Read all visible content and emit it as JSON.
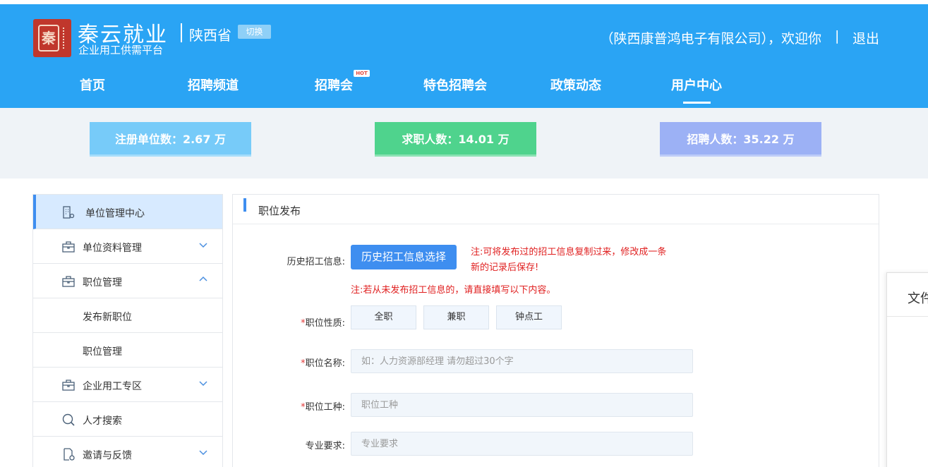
{
  "header": {
    "brand_title": "秦云就业",
    "brand_sub": "企业用工供需平台",
    "seal_char": "秦",
    "province": "陕西省",
    "switch_label": "切换",
    "welcome": "（陕西康普鸿电子有限公司），欢迎你",
    "separator": "|",
    "logout": "退出",
    "brand_color": "#2aa4f4"
  },
  "nav": {
    "items": [
      {
        "label": "首页"
      },
      {
        "label": "招聘频道"
      },
      {
        "label": "招聘会",
        "badge": "HOT"
      },
      {
        "label": "特色招聘会"
      },
      {
        "label": "政策动态"
      },
      {
        "label": "用户中心",
        "active": true
      }
    ]
  },
  "stats": [
    {
      "label": "注册单位数：2.67 万",
      "color": "#77cbf9"
    },
    {
      "label": "求职人数：14.01 万",
      "color": "#4fd38d"
    },
    {
      "label": "招聘人数：35.22 万",
      "color": "#9cb1f5"
    }
  ],
  "sidebar": {
    "items": [
      {
        "label": "单位管理中心",
        "icon": "building-icon",
        "active": true
      },
      {
        "label": "单位资料管理",
        "icon": "briefcase-icon",
        "chevron": "down"
      },
      {
        "label": "职位管理",
        "icon": "briefcase-icon",
        "chevron": "up"
      },
      {
        "label": "发布新职位"
      },
      {
        "label": "职位管理"
      },
      {
        "label": "企业用工专区",
        "icon": "briefcase-icon",
        "chevron": "down"
      },
      {
        "label": "人才搜索",
        "icon": "search-icon"
      },
      {
        "label": "邀请与反馈",
        "icon": "document-gear-icon",
        "chevron": "down"
      }
    ]
  },
  "panel": {
    "title": "职位发布",
    "history_label": "历史招工信息:",
    "history_button": "历史招工信息选择",
    "note1_line1": "注:可将发布过的招工信息复制过来，修改成一条",
    "note1_line2": "新的记录后保存!",
    "note2": "注:若从未发布招工信息的，请直接填写以下内容。",
    "required_mark": "*",
    "nature_label": "职位性质:",
    "nature_options": [
      "全职",
      "兼职",
      "钟点工"
    ],
    "name_label": "职位名称:",
    "name_placeholder": "如：人力资源部经理 请勿超过30个字",
    "type_label": "职位工种:",
    "type_placeholder": "职位工种",
    "major_label": "专业要求:",
    "major_placeholder": "专业要求"
  },
  "dialog": {
    "title": "文件"
  }
}
